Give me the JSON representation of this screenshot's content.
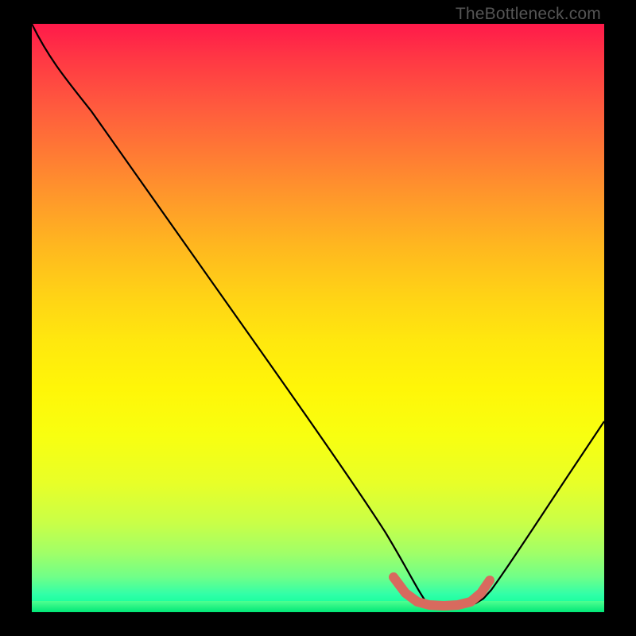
{
  "watermark": "TheBottleneck.com",
  "chart_data": {
    "type": "line",
    "title": "",
    "xlabel": "",
    "ylabel": "",
    "xlim": [
      0,
      100
    ],
    "ylim": [
      0,
      100
    ],
    "series": [
      {
        "name": "bottleneck-curve",
        "x": [
          0,
          5,
          12,
          25,
          40,
          55,
          62,
          65,
          68,
          72,
          75,
          78,
          80,
          88,
          100
        ],
        "y": [
          100,
          94,
          86,
          68,
          47,
          26,
          14,
          6,
          2,
          1,
          1,
          2,
          5,
          15,
          33
        ]
      }
    ],
    "highlight_segment": {
      "name": "optimal-range",
      "x": [
        63,
        66,
        70,
        74,
        77,
        79
      ],
      "y": [
        6,
        2,
        1,
        1,
        2,
        5
      ],
      "color": "#d86a5e"
    },
    "background_gradient": {
      "top": "#ff1a4a",
      "middle": "#ffe80e",
      "bottom": "#00e878"
    }
  }
}
